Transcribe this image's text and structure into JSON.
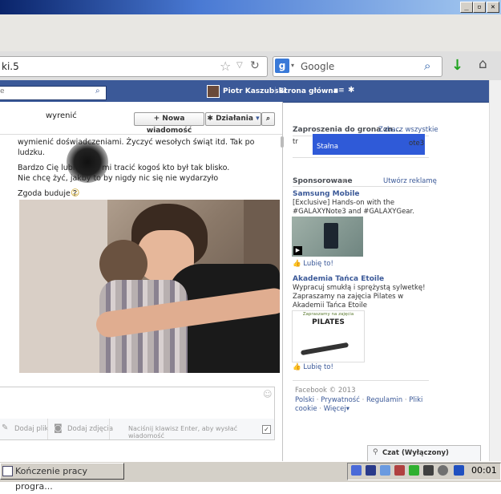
{
  "window": {
    "min": "_",
    "max": "▫",
    "close": "✕"
  },
  "browser": {
    "url": "ki.5",
    "search_placeholder": "Google",
    "search_engine_letter": "g"
  },
  "fb": {
    "user_name": "Piotr Kaszubski",
    "home_label": "Strona główna"
  },
  "chat": {
    "recipient": "wyrenić",
    "new_message_label": "+ Nowa wiadomość",
    "actions_label": "Działania",
    "messages": {
      "line1": "wymienić doświadczeniami. Życzyć wesołych świąt itd. Tak po",
      "line2": "ludzku.",
      "line3": "Bardzo Cię lubię,       i żal mi tracić kogoś kto był tak blisko.",
      "line4": "Nie chcę żyć, jakby to by nigdy nic się nie wydarzyło",
      "line5": "Zgoda buduje ?"
    },
    "attach_file_label": "Dodaj plik",
    "attach_photo_label": "Dodaj zdjęcia",
    "enter_hint": "Naciśnij klawisz Enter, aby wysłać wiadomość"
  },
  "sidebar": {
    "invites_title": "Zaproszenia do grona zn...",
    "invites_link": "Zobacz wszystkie",
    "invite_visible_1": "tr",
    "invite_visible_2": "ote3",
    "invite_visible_3": "Stałna",
    "sponsored_title": "Sponsorowane",
    "create_ad": "Utwórz reklamę",
    "ads": [
      {
        "title": "Samsung Mobile",
        "text": "[Exclusive] Hands-on with the #GALAXYNote3 and #GALAXYGear.",
        "like": "Lubię to!"
      },
      {
        "title": "Akademia Tańca Etoile",
        "text": "Wypracuj smukłą i sprężystą sylwetkę! Zapraszamy na zajęcia Pilates w Akademii Tańca Etoile",
        "like": "Lubię to!",
        "image_heading": "Zapraszamy na zajęcia",
        "image_title": "PILATES"
      }
    ],
    "footer_copy": "Facebook © 2013",
    "footer_links": [
      "Polski",
      "Prywatność",
      "Regulamin",
      "Pliki cookie",
      "Więcej"
    ],
    "chat_status": "Czat (Wyłączony)"
  },
  "taskbar": {
    "task_label": "Kończenie pracy progra...",
    "clock": "00:01"
  }
}
